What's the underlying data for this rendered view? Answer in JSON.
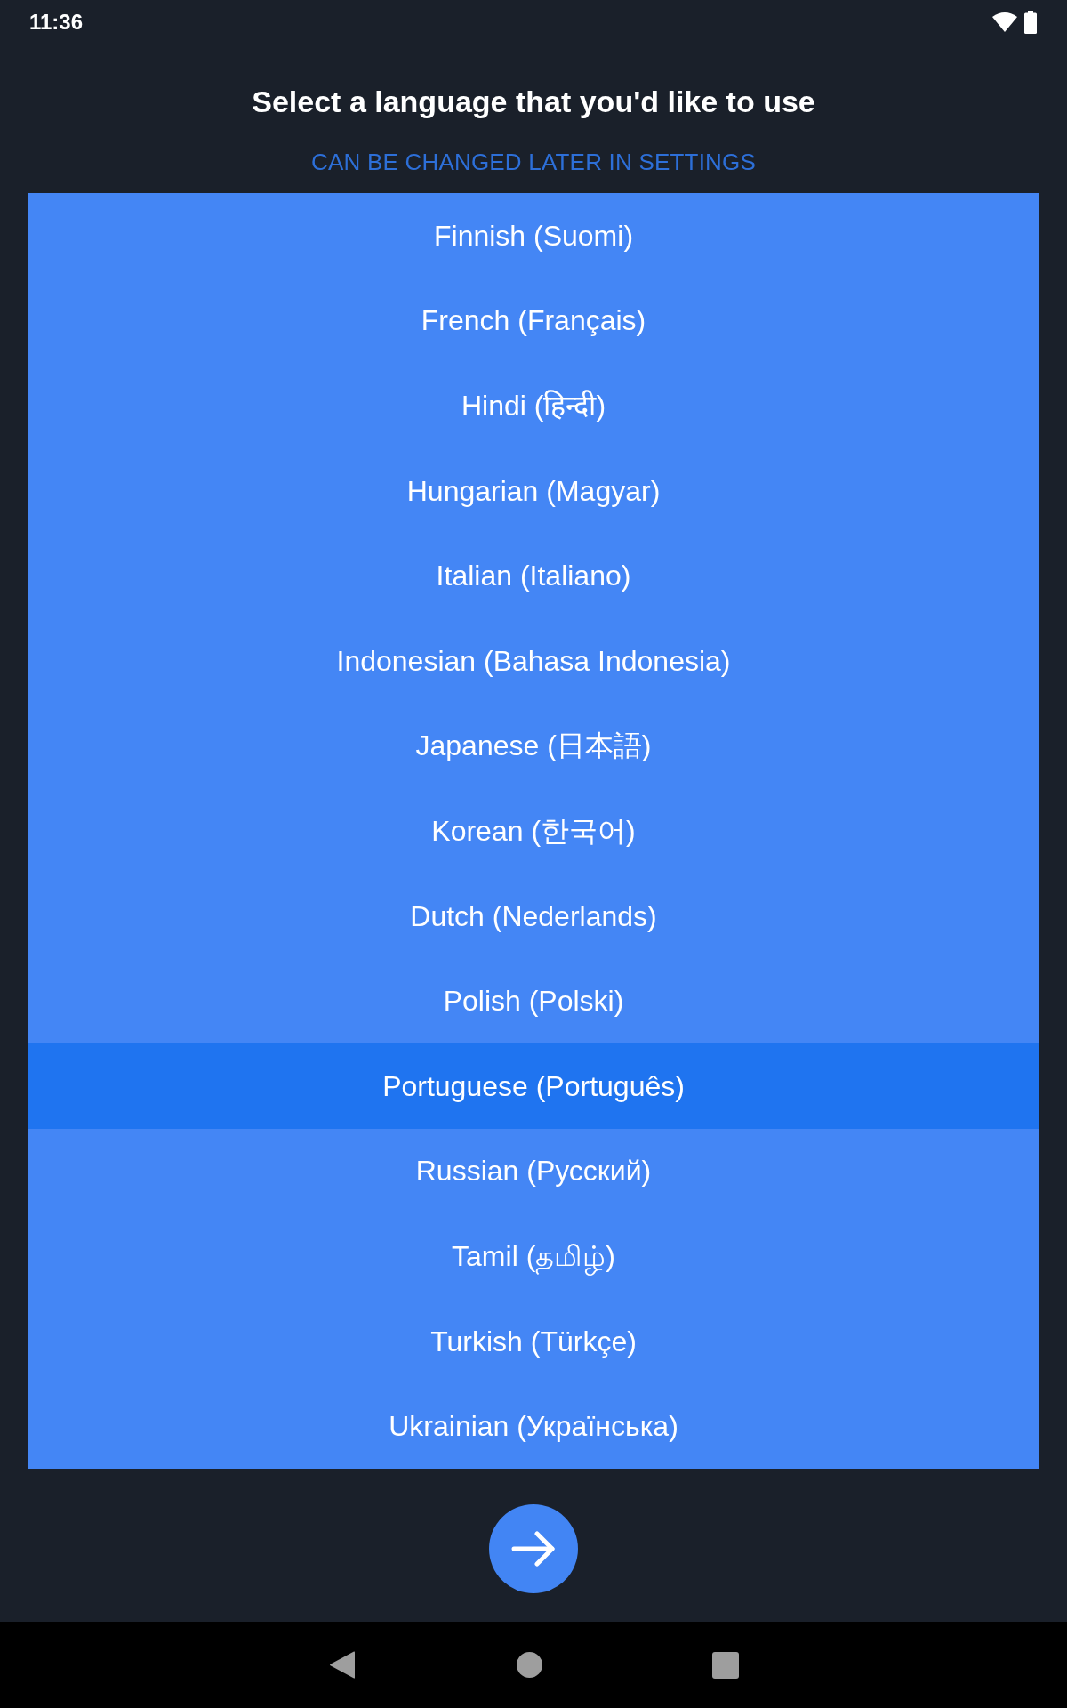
{
  "status_bar": {
    "time": "11:36"
  },
  "header": {
    "title": "Select a language that you'd like to use",
    "subtitle": "CAN BE CHANGED LATER IN SETTINGS"
  },
  "languages": [
    {
      "label": "Finnish (Suomi)",
      "selected": false
    },
    {
      "label": "French (Français)",
      "selected": false
    },
    {
      "label": "Hindi (हिन्दी)",
      "selected": false
    },
    {
      "label": "Hungarian (Magyar)",
      "selected": false
    },
    {
      "label": "Italian (Italiano)",
      "selected": false
    },
    {
      "label": "Indonesian (Bahasa Indonesia)",
      "selected": false
    },
    {
      "label": "Japanese (日本語)",
      "selected": false
    },
    {
      "label": "Korean (한국어)",
      "selected": false
    },
    {
      "label": "Dutch (Nederlands)",
      "selected": false
    },
    {
      "label": "Polish (Polski)",
      "selected": false
    },
    {
      "label": "Portuguese (Português)",
      "selected": true
    },
    {
      "label": "Russian (Русский)",
      "selected": false
    },
    {
      "label": "Tamil (தமிழ்)",
      "selected": false
    },
    {
      "label": "Turkish (Türkçe)",
      "selected": false
    },
    {
      "label": "Ukrainian (Українська)",
      "selected": false
    }
  ]
}
